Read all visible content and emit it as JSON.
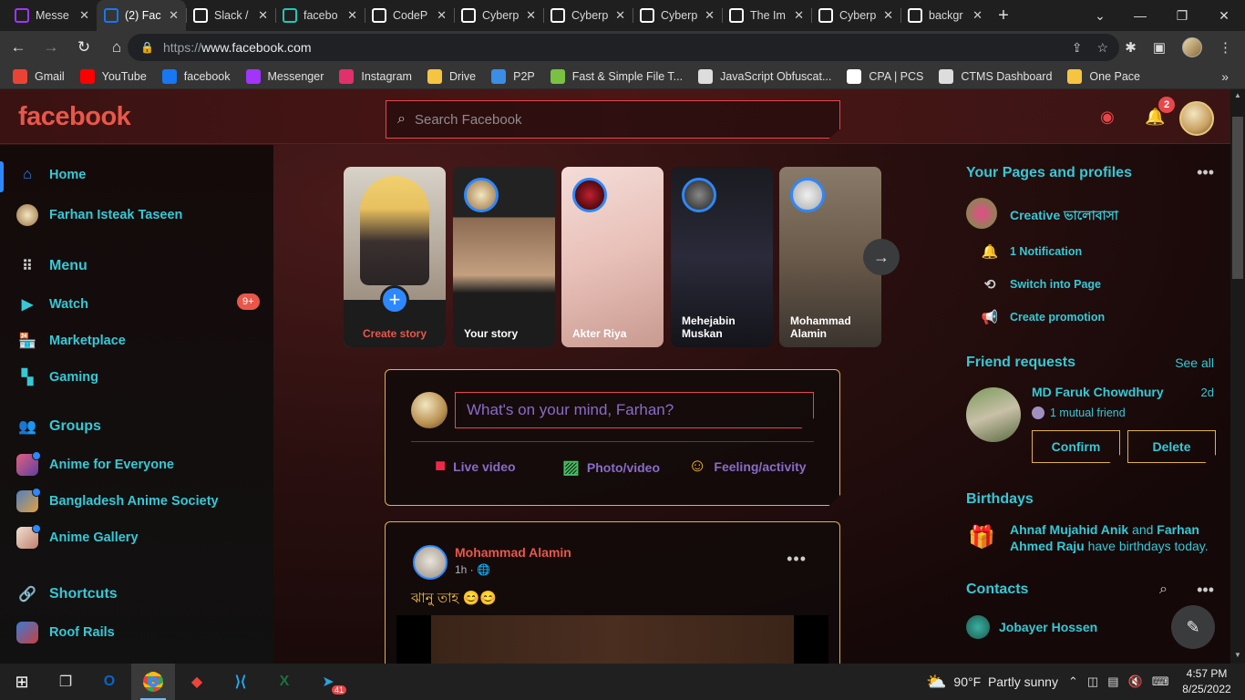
{
  "browser": {
    "tabs": [
      {
        "title": "Messe",
        "icon": "messenger-icon",
        "color": "#a334fa"
      },
      {
        "title": "(2) Fac",
        "icon": "facebook-icon",
        "color": "#1877f2",
        "active": true
      },
      {
        "title": "Slack /",
        "icon": "codepen-icon",
        "color": "#ffffff"
      },
      {
        "title": "facebo",
        "icon": "s-icon",
        "color": "#1ec9b8"
      },
      {
        "title": "CodeP",
        "icon": "codepen-icon",
        "color": "#ffffff"
      },
      {
        "title": "Cyberp",
        "icon": "codepen-icon",
        "color": "#ffffff"
      },
      {
        "title": "Cyberp",
        "icon": "codepen-icon",
        "color": "#ffffff"
      },
      {
        "title": "Cyberp",
        "icon": "codepen-icon",
        "color": "#ffffff"
      },
      {
        "title": "The Im",
        "icon": "codepen-icon",
        "color": "#ffffff"
      },
      {
        "title": "Cyberp",
        "icon": "codepen-icon",
        "color": "#ffffff"
      },
      {
        "title": "backgr",
        "icon": "google-icon",
        "color": "#ffffff"
      }
    ],
    "url_scheme": "https://",
    "url_host": "www.facebook.com",
    "bookmarks": [
      {
        "label": "Gmail",
        "icon": "gmail-icon",
        "color": "#ea4335"
      },
      {
        "label": "YouTube",
        "icon": "youtube-icon",
        "color": "#ff0000"
      },
      {
        "label": "facebook",
        "icon": "facebook-icon",
        "color": "#1877f2"
      },
      {
        "label": "Messenger",
        "icon": "messenger-icon",
        "color": "#a334fa"
      },
      {
        "label": "Instagram",
        "icon": "instagram-icon",
        "color": "#e1306c"
      },
      {
        "label": "Drive",
        "icon": "folder-icon",
        "color": "#f5c542"
      },
      {
        "label": "P2P",
        "icon": "p2p-icon",
        "color": "#3a8ee6"
      },
      {
        "label": "Fast & Simple File T...",
        "icon": "circle-icon",
        "color": "#7ac143"
      },
      {
        "label": "JavaScript Obfuscat...",
        "icon": "globe-icon",
        "color": "#dddddd"
      },
      {
        "label": "CPA | PCS",
        "icon": "cpa-icon",
        "color": "#ffffff"
      },
      {
        "label": "CTMS Dashboard",
        "icon": "globe-icon",
        "color": "#dddddd"
      },
      {
        "label": "One Pace",
        "icon": "straw-hat-icon",
        "color": "#f5c542"
      }
    ]
  },
  "fb": {
    "logo": "facebook",
    "search_placeholder": "Search Facebook",
    "notification_count": "2",
    "sidebar": {
      "home": "Home",
      "profile": "Farhan Isteak Taseen",
      "menu": "Menu",
      "watch": "Watch",
      "watch_badge": "9+",
      "marketplace": "Marketplace",
      "gaming": "Gaming",
      "groups": "Groups",
      "group_items": [
        "Anime for Everyone",
        "Bangladesh Anime Society",
        "Anime Gallery"
      ],
      "shortcuts": "Shortcuts",
      "shortcut_items": [
        "Roof Rails"
      ]
    },
    "stories": {
      "create": "Create story",
      "items": [
        "Your story",
        "Akter Riya",
        "Mehejabin Muskan",
        "Mohammad Alamin"
      ]
    },
    "composer": {
      "placeholder": "What's on your mind, Farhan?",
      "live": "Live video",
      "photo": "Photo/video",
      "feeling": "Feeling/activity"
    },
    "post": {
      "author": "Mohammad Alamin",
      "time": "1h ·",
      "text": "ঝানু তাহ 😊😊"
    },
    "right": {
      "pages_title": "Your Pages and profiles",
      "page_name": "Creative ভালোবাসা",
      "notif": "1 Notification",
      "switch": "Switch into Page",
      "promo": "Create promotion",
      "fr_title": "Friend requests",
      "see_all": "See all",
      "fr_name": "MD Faruk Chowdhury",
      "fr_time": "2d",
      "fr_mutual": "1 mutual friend",
      "confirm": "Confirm",
      "delete": "Delete",
      "bd_title": "Birthdays",
      "bd_name1": "Ahnaf Mujahid Anik",
      "bd_and": " and ",
      "bd_name2": "Farhan Ahmed Raju",
      "bd_rest": " have birthdays today.",
      "contacts_title": "Contacts",
      "contact1": "Jobayer Hossen"
    }
  },
  "taskbar": {
    "temp": "90°F",
    "weather": "Partly sunny",
    "time": "4:57 PM",
    "date": "8/25/2022",
    "telegram_badge": "41"
  }
}
